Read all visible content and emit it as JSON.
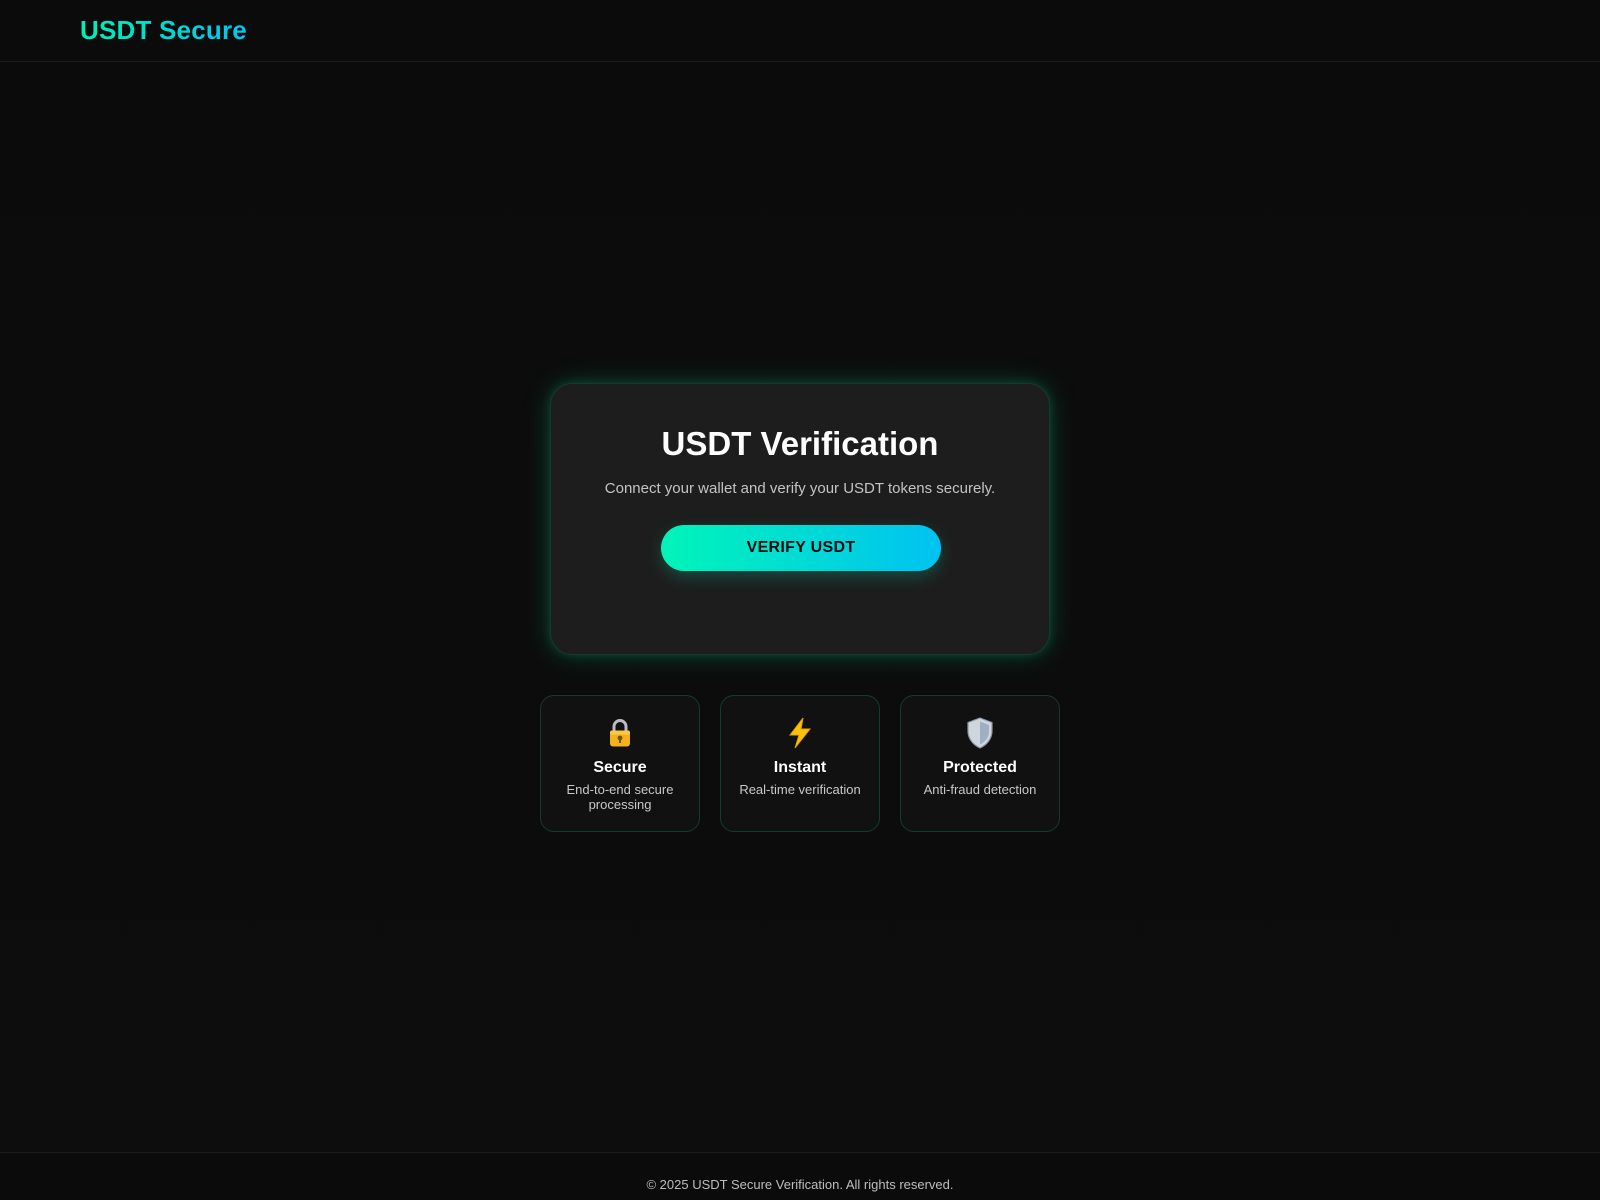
{
  "header": {
    "logo_text": "USDT Secure"
  },
  "verification_card": {
    "title": "USDT Verification",
    "subtitle": "Connect your wallet and verify your USDT tokens securely.",
    "button_label": "VERIFY USDT"
  },
  "features": [
    {
      "icon": "lock-icon",
      "title": "Secure",
      "description": "End-to-end secure processing"
    },
    {
      "icon": "lightning-icon",
      "title": "Instant",
      "description": "Real-time verification"
    },
    {
      "icon": "shield-icon",
      "title": "Protected",
      "description": "Anti-fraud detection"
    }
  ],
  "footer": {
    "text": "© 2025 USDT Secure Verification. All rights reserved."
  },
  "colors": {
    "accent_start": "#00f5b8",
    "accent_end": "#00c2f2",
    "background": "#0c0c0c",
    "card_background": "#1d1d1d"
  }
}
